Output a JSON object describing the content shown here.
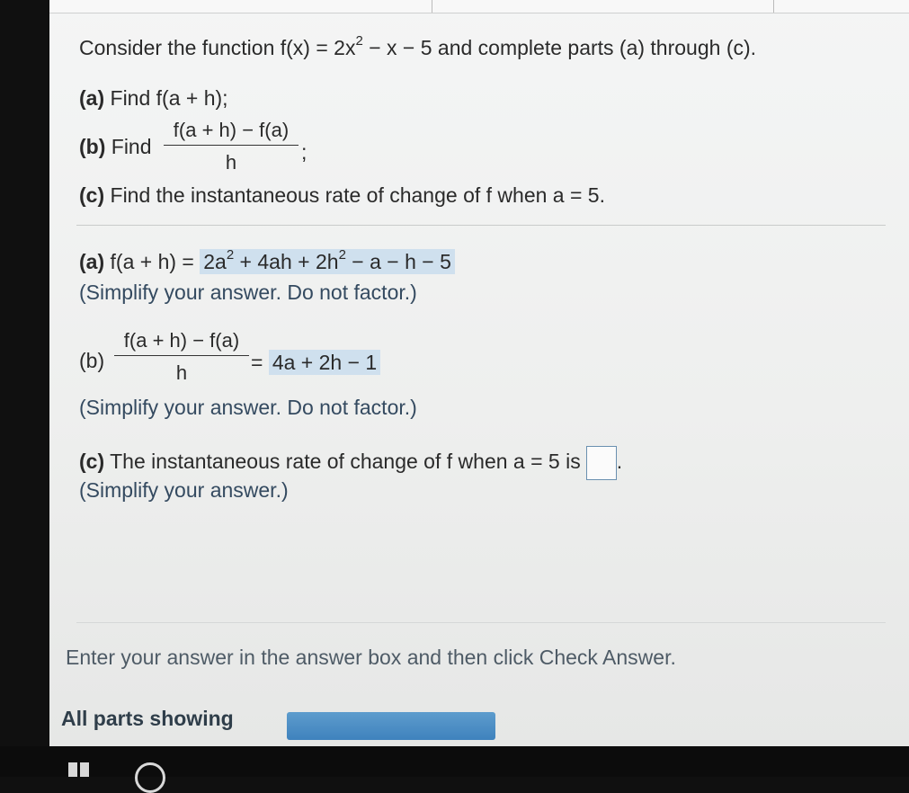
{
  "question": {
    "intro_pre": "Consider the function f(x) = 2x",
    "intro_exp": "2",
    "intro_post": " − x − 5 and complete parts (a) through (c).",
    "part_a_tag": "(a)",
    "part_a_text": "Find f(a + h);",
    "part_b_tag": "(b)",
    "part_b_text": "Find",
    "part_b_num": "f(a + h) − f(a)",
    "part_b_den": "h",
    "part_b_end": ";",
    "part_c_tag": "(c)",
    "part_c_text": "Find the instantaneous rate of change of f when a = 5."
  },
  "answers": {
    "a_tag": "(a)",
    "a_lhs": "f(a + h) =",
    "a_ans_1": "2a",
    "a_ans_exp1": "2",
    "a_ans_2": " + 4ah + 2h",
    "a_ans_exp2": "2",
    "a_ans_3": " − a − h − 5",
    "a_note": "(Simplify your answer. Do not factor.)",
    "b_tag": "(b)",
    "b_num": "f(a + h) − f(a)",
    "b_den": "h",
    "b_eq": "=",
    "b_ans": "4a + 2h − 1",
    "b_note": "(Simplify your answer. Do not factor.)",
    "c_tag": "(c)",
    "c_text": "The instantaneous rate of change of f when a = 5 is",
    "c_end": ".",
    "c_note": "(Simplify your answer.)"
  },
  "footer": {
    "instruction": "Enter your answer in the answer box and then click Check Answer.",
    "parts_label": "All parts showing"
  },
  "colors": {
    "highlight": "#cfe0ee",
    "progress": "#4a8cc4"
  }
}
